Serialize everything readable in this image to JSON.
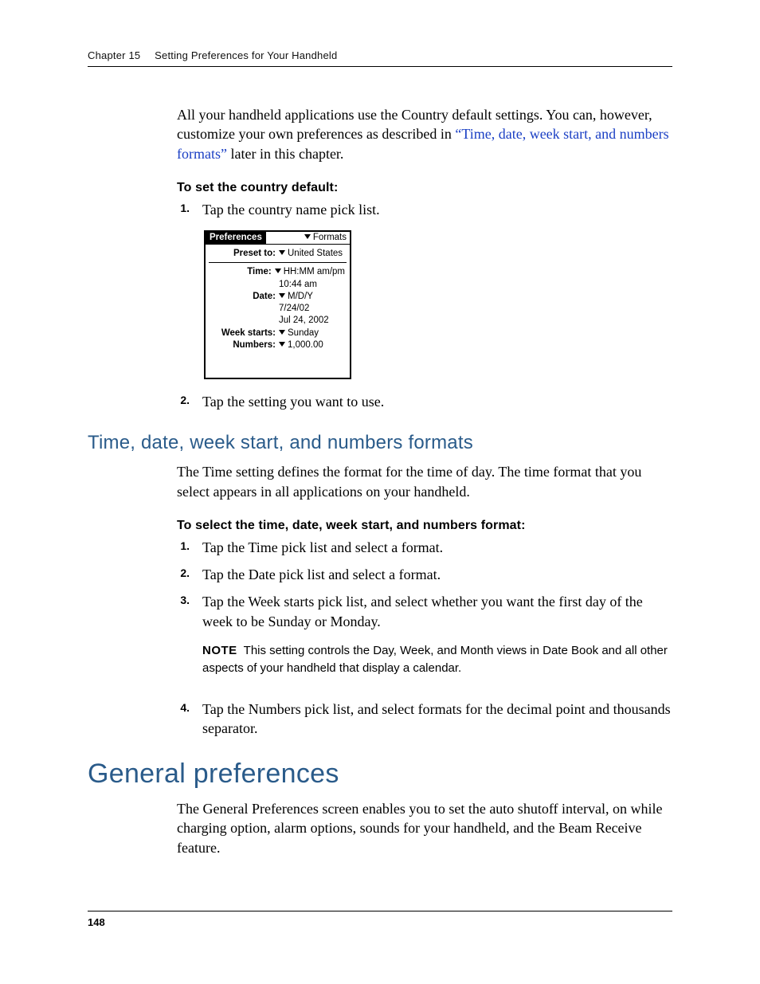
{
  "header": {
    "chapter": "Chapter 15",
    "title": "Setting Preferences for Your Handheld"
  },
  "intro": {
    "pre": "All your handheld applications use the Country default settings. You can, however, customize your own preferences as described in ",
    "link": "“Time, date, week start, and numbers formats”",
    "post": " later in this chapter."
  },
  "section_country": {
    "heading": "To set the country default:",
    "step1": "Tap the country name pick list.",
    "step2": "Tap the setting you want to use."
  },
  "palm": {
    "title": "Preferences",
    "menu": "Formats",
    "preset_label": "Preset to:",
    "preset_value": "United States",
    "time_label": "Time:",
    "time_format": "HH:MM am/pm",
    "time_example": "10:44 am",
    "date_label": "Date:",
    "date_format": "M/D/Y",
    "date_example1": "7/24/02",
    "date_example2": "Jul 24, 2002",
    "week_label": "Week starts:",
    "week_value": "Sunday",
    "numbers_label": "Numbers:",
    "numbers_value": "1,000.00"
  },
  "section_formats": {
    "title": "Time, date, week start, and numbers formats",
    "intro": "The Time setting defines the format for the time of day. The time format that you select appears in all applications on your handheld.",
    "heading": "To select the time, date, week start, and numbers format:",
    "step1": "Tap the Time pick list and select a format.",
    "step2": "Tap the Date pick list and select a format.",
    "step3": "Tap the Week starts pick list, and select whether you want the first day of the week to be Sunday or Monday.",
    "note_label": "NOTE",
    "note_body": "This setting controls the Day, Week, and Month views in Date Book and all other aspects of your handheld that display a calendar.",
    "step4": "Tap the Numbers pick list, and select formats for the decimal point and thousands separator."
  },
  "section_general": {
    "title": "General preferences",
    "body": "The General Preferences screen enables you to set the auto shutoff interval, on while charging option, alarm options, sounds for your handheld, and the Beam Receive feature."
  },
  "page_number": "148"
}
